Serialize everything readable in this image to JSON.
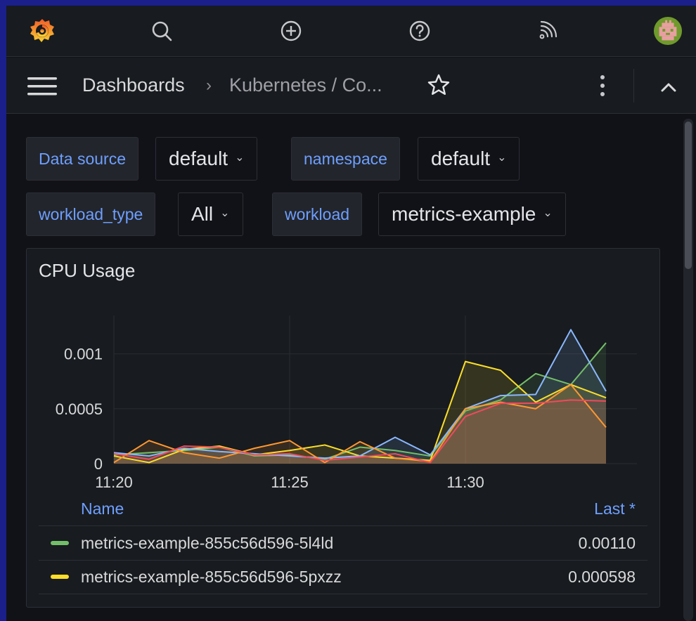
{
  "topbar": {
    "icons": [
      "grafana-logo-icon",
      "search-icon",
      "add-icon",
      "help-icon",
      "news-rss-icon",
      "user-avatar"
    ]
  },
  "nav": {
    "breadcrumb_root": "Dashboards",
    "breadcrumb_separator": "›",
    "breadcrumb_current": "Kubernetes / Co..."
  },
  "variables": [
    {
      "label": "Data source",
      "value": "default"
    },
    {
      "label": "namespace",
      "value": "default"
    },
    {
      "label": "workload_type",
      "value": "All"
    },
    {
      "label": "workload",
      "value": "metrics-example"
    }
  ],
  "panel": {
    "title": "CPU Usage"
  },
  "chart_data": {
    "type": "line",
    "title": "CPU Usage",
    "x_labels": [
      "11:20",
      "11:25",
      "11:30"
    ],
    "y_ticks": [
      "0",
      "0.0005",
      "0.001"
    ],
    "ylim": [
      0,
      0.00135
    ],
    "x_times": [
      "11:20",
      "11:21",
      "11:22",
      "11:23",
      "11:24",
      "11:25",
      "11:26",
      "11:27",
      "11:28",
      "11:29",
      "11:30",
      "11:31",
      "11:32",
      "11:33",
      "11:34"
    ],
    "grid": true,
    "fill": "area",
    "series": [
      {
        "name": "metrics-example-855c56d596-5l4ld",
        "color": "#73bf69",
        "values": [
          8e-05,
          0.0001,
          0.00012,
          0.00015,
          7e-05,
          8e-05,
          4e-05,
          0.00015,
          0.00012,
          7e-05,
          0.00048,
          0.00058,
          0.00082,
          0.00072,
          0.0011
        ]
      },
      {
        "name": "metrics-example-855c56d596-5pxzz",
        "color": "#fade2a",
        "values": [
          7e-05,
          1e-05,
          0.00013,
          0.00016,
          8e-05,
          0.00012,
          0.00017,
          7e-05,
          5e-05,
          3e-05,
          0.00093,
          0.00085,
          0.00056,
          0.00072,
          0.0006
        ]
      },
      {
        "color": "#8ab8ff",
        "values": [
          0.0001,
          7e-05,
          0.00014,
          0.00011,
          9e-05,
          7e-05,
          5e-05,
          7e-05,
          0.00024,
          8e-05,
          0.0005,
          0.00062,
          0.00063,
          0.00122,
          0.00066
        ]
      },
      {
        "color": "#ff9830",
        "values": [
          1e-05,
          0.00021,
          0.0001,
          5e-05,
          0.00014,
          0.00021,
          1e-05,
          0.0002,
          5e-05,
          2e-05,
          0.0005,
          0.00056,
          0.0005,
          0.00072,
          0.00033
        ]
      },
      {
        "color": "#f2495c",
        "values": [
          9e-05,
          4e-05,
          0.00016,
          0.00015,
          8e-05,
          9e-05,
          3e-05,
          6e-05,
          9e-05,
          1e-05,
          0.00043,
          0.00055,
          0.00055,
          0.00058,
          0.00057
        ]
      }
    ],
    "legend": {
      "header_name": "Name",
      "header_last": "Last *",
      "entries": [
        {
          "name": "metrics-example-855c56d596-5l4ld",
          "color": "#73bf69",
          "last": "0.00110"
        },
        {
          "name": "metrics-example-855c56d596-5pxzz",
          "color": "#fade2a",
          "last": "0.000598"
        }
      ]
    }
  }
}
